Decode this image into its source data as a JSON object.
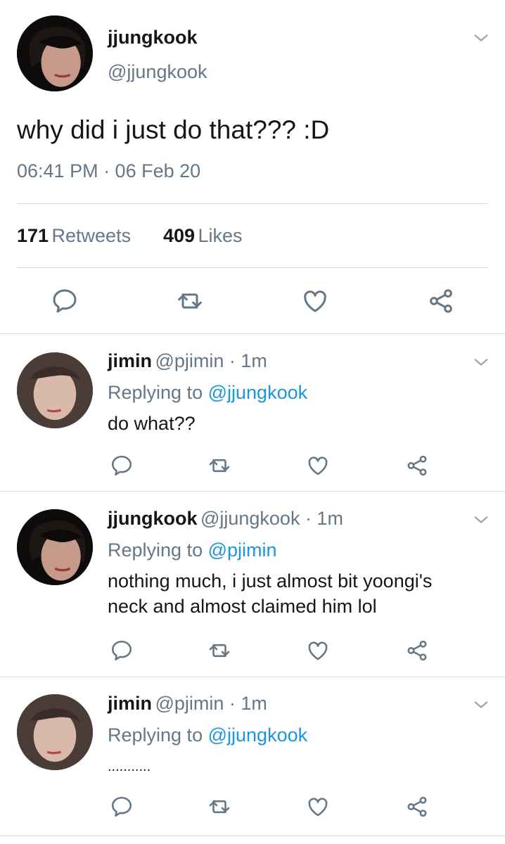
{
  "colors": {
    "text": "#14171a",
    "secondary": "#657786",
    "link": "#1b95e0",
    "divider": "#d9dee3"
  },
  "main_tweet": {
    "name": "jjungkook",
    "handle": "@jjungkook",
    "text": "why did i just do that??? :D",
    "timestamp": "06:41 PM · 06 Feb 20",
    "retweets_count": "171",
    "retweets_label": "Retweets",
    "likes_count": "409",
    "likes_label": "Likes",
    "avatar_icon": "avatar-jungkook",
    "menu_icon": "chevron-down-icon"
  },
  "replies": [
    {
      "name": "jimin",
      "handle_time": "@pjimin · 1m",
      "replying_prefix": "Replying to",
      "replying_to": "@jjungkook",
      "text_lines": [
        "do what??"
      ]
    },
    {
      "name": "jjungkook",
      "handle_time": "@jjungkook · 1m",
      "replying_prefix": "Replying to",
      "replying_to": "@pjimin",
      "text_lines": [
        "nothing much, i just almost bit yoongi's",
        "neck and almost claimed him lol"
      ]
    },
    {
      "name": "jimin",
      "handle_time": "@pjimin · 1m",
      "replying_prefix": "Replying to",
      "replying_to": "@jjungkook",
      "text_lines": [
        "..........."
      ]
    }
  ],
  "action_icons": [
    "reply-icon",
    "retweet-icon",
    "like-icon",
    "share-icon"
  ]
}
